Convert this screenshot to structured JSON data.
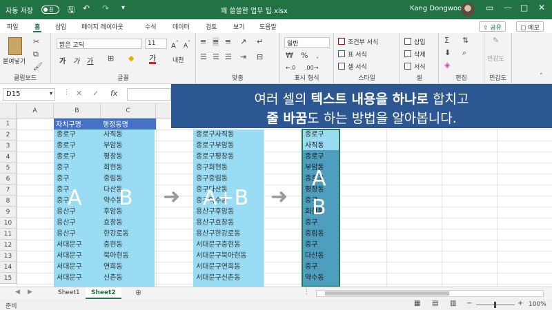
{
  "titlebar": {
    "autosave_label": "자동 저장",
    "autosave_state": "끔",
    "filename": "꽤 쓸쓸한 업무 팁.xlsx",
    "user_name": "Kang Dongwoo"
  },
  "tabs": [
    "파일",
    "홈",
    "삽입",
    "페이지 레이아웃",
    "수식",
    "데이터",
    "검토",
    "보기",
    "도움말"
  ],
  "top_buttons": {
    "share": "공유",
    "comment": "메모"
  },
  "ribbon": {
    "clipboard": {
      "paste": "붙여넣기",
      "label": "클립보드"
    },
    "font": {
      "name": "맑은 고딕",
      "size": "11",
      "label": "글꼴"
    },
    "alignment": {
      "label": "맞춤"
    },
    "number": {
      "format": "일반",
      "label": "표시 형식"
    },
    "styles": {
      "conditional": "조건부 서식",
      "table": "표 서식",
      "cell": "셀 서식",
      "label": "스타일"
    },
    "cells": {
      "insert": "삽입",
      "delete": "삭제",
      "format": "서식",
      "label": "셀"
    },
    "editing": {
      "label": "편집"
    },
    "sensitivity": {
      "button": "민감도",
      "label": "민감도"
    }
  },
  "formula_bar": {
    "name_box": "D15"
  },
  "banner": {
    "line1_a": "여러 셀의 ",
    "line1_b": "텍스트 내용을 하나로",
    "line1_c": " 합치고",
    "line2_a": "줄 바꿈",
    "line2_b": "도 하는 방법을 알아봅니다."
  },
  "columns": [
    "A",
    "B",
    "C"
  ],
  "rows": [
    "1",
    "2",
    "3",
    "4",
    "5",
    "6",
    "7",
    "8",
    "9",
    "10",
    "11",
    "12",
    "13",
    "14",
    "15"
  ],
  "table": {
    "headers": [
      "자치구명",
      "행정동명"
    ],
    "gu": [
      "종로구",
      "종로구",
      "종로구",
      "중구",
      "중구",
      "중구",
      "중구",
      "용산구",
      "용산구",
      "용산구",
      "서대문구",
      "서대문구",
      "서대문구",
      "서대문구"
    ],
    "dong": [
      "사직동",
      "부암동",
      "평창동",
      "회현동",
      "중림동",
      "다산동",
      "약수동",
      "후암동",
      "효창동",
      "한강로동",
      "충현동",
      "북아현동",
      "연희동",
      "신촌동"
    ],
    "combined": [
      "종로구사직동",
      "종로구부암동",
      "종로구평창동",
      "중구회현동",
      "중구중림동",
      "중구다산동",
      "중구약수동",
      "용산구후암동",
      "용산구효창동",
      "용산구한강로동",
      "서대문구충현동",
      "서대문구북아현동",
      "서대문구연희동",
      "서대문구신촌동"
    ],
    "wrapped": [
      "종로구",
      "사직동",
      "종로구",
      "부암동",
      "종로구",
      "평창동",
      "중구",
      "회현동",
      "중구",
      "중림동",
      "중구",
      "다산동",
      "중구",
      "약수동"
    ]
  },
  "overlay": {
    "a": "A",
    "b": "B",
    "ab": "A+B",
    "wrap_a": "A",
    "wrap_b": "B",
    "arrow": "➜"
  },
  "sheets": [
    "Sheet1",
    "Sheet2"
  ],
  "status": {
    "ready": "준비",
    "zoom": "100%"
  },
  "colors": {
    "excel_green": "#217346",
    "banner_blue": "#2c5793",
    "highlight": "#9adcf4",
    "header_blue": "#4472c4"
  }
}
